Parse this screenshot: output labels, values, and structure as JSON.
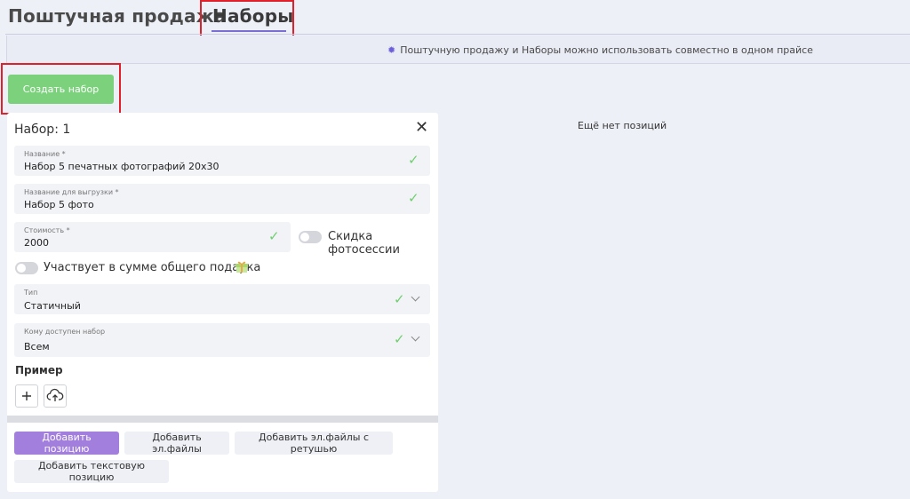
{
  "tabs": {
    "retail": "Поштучная продажа",
    "sets": "Наборы"
  },
  "info": {
    "text": "Поштучную продажу и Наборы можно использовать совместно в одном прайсе",
    "icon": "lightbulb-icon"
  },
  "create_button": "Создать набор",
  "empty_text": "Ещё нет позиций",
  "card": {
    "title": "Набор: 1",
    "name_field": {
      "label": "Название *",
      "value": "Набор 5 печатных фотографий 20х30"
    },
    "export_name_field": {
      "label": "Название для выгрузки *",
      "value": "Набор 5 фото"
    },
    "price_field": {
      "label": "Стоимость *",
      "value": "2000"
    },
    "session_discount_label": "Скидка фотосессии",
    "gift_label": "Участвует в сумме общего подарка",
    "type_field": {
      "label": "Тип",
      "value": "Статичный"
    },
    "availability_field": {
      "label": "Кому доступен набор",
      "value": "Всем"
    },
    "example_label": "Пример",
    "actions": {
      "add_position": "Добавить позицию",
      "add_files": "Добавить эл.файлы",
      "add_files_retouch": "Добавить эл.файлы с ретушью",
      "add_text_position": "Добавить текстовую позицию"
    }
  },
  "colors": {
    "accent": "#7b6fd6",
    "create": "#7cd27c",
    "primary_action": "#a27fdc",
    "check": "#6fcf6f",
    "highlight": "#e0202a"
  }
}
